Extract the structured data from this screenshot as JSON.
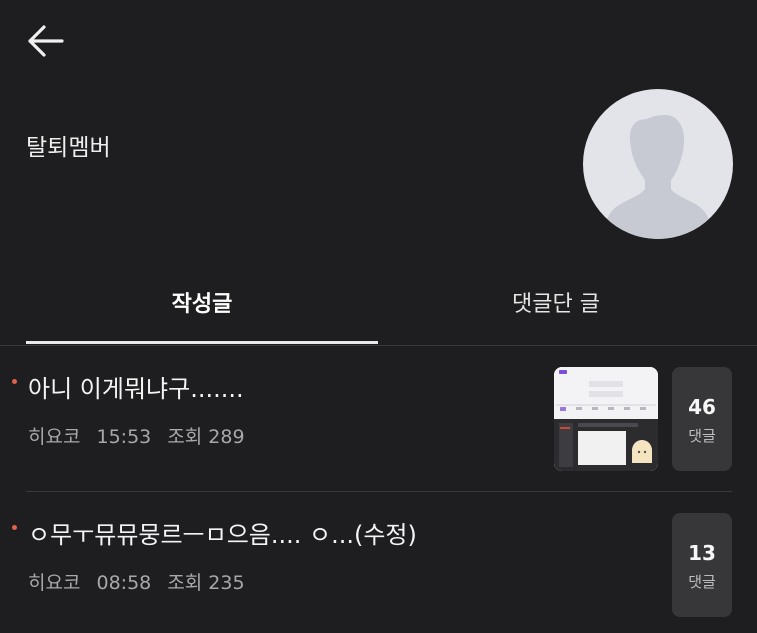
{
  "profile": {
    "name": "탈퇴멤버"
  },
  "tabs": [
    {
      "label": "작성글",
      "active": true
    },
    {
      "label": "댓글단 글",
      "active": false
    }
  ],
  "posts": [
    {
      "title": "아니 이게뭐냐구.......",
      "author": "히요코",
      "time": "15:53",
      "views": "조회 289",
      "comment_count": "46",
      "comment_label": "댓글",
      "has_thumbnail": true
    },
    {
      "title": "ㅇ무ㅜ뮤뮤뭉르ㅡㅁ으음.... ㅇ...(수정)",
      "author": "히요코",
      "time": "08:58",
      "views": "조회 235",
      "comment_count": "13",
      "comment_label": "댓글",
      "has_thumbnail": false
    }
  ],
  "colors": {
    "background": "#1e1d1f",
    "new_dot": "#e0624a",
    "comment_box": "#373639"
  },
  "icons": {
    "back": "arrow-left-icon",
    "avatar": "default-user-silhouette"
  }
}
